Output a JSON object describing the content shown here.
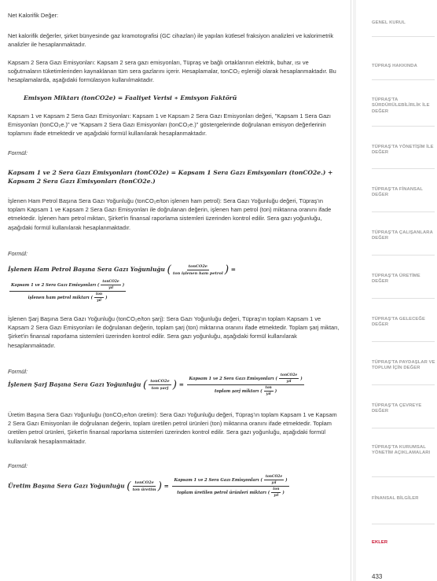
{
  "content": {
    "heading": "Net Kalorifik Değer:",
    "p1": "Net kalorifik değerler, şirket bünyesinde gaz kramotografisi (GC cihazları) ile yapılan kütlesel fraksiyon analizleri ve kalorimetrik analizler ile hesaplanmaktadır.",
    "p2": "Kapsam 2 Sera Gazı Emisyonları: Kapsam 2 sera gazı emisyonları, Tüpraş ve bağlı ortaklarının elektrik, buhar, ısı ve soğutmaların tüketimlerinden kaynaklanan tüm sera gazlarını içerir. Hesaplamalar, tonCO₂ eşleniği olarak hesaplanmaktadır. Bu hesaplamalarda, aşağıdaki formülasyon kullanılmaktadır.",
    "eq1": "Emisyon Miktarı (tonCO2e) = Faaliyet Verisi ∗ Emisyon Faktörü",
    "p3": "Kapsam 1 ve Kapsam 2 Sera Gazı Emisyonları: Kapsam 1 ve Kapsam 2 Sera Gazı Emisyonları değeri, \"Kapsam 1 Sera Gazı Emisyonları (tonCO₂e.)\" ve \"Kapsam 2 Sera Gazı Emisyonları (tonCO₂e.)\" göstergelerinde doğrulanan emisyon değerlerinin toplamını ifade etmektedir ve aşağıdaki formül kullanılarak hesaplanmaktadır.",
    "formula_label": "Formül:",
    "eq2_line1": "Kapsam 1 ve 2 Sera Gazı Emisyonları (tonCO2e) = Kapsam 1 Sera Gazı Emisyonları (tonCO2e.) +",
    "eq2_line2": "Kapsam 2 Sera Gazı Emisyonları (tonCO2e.)",
    "p4": "İşlenen Ham Petrol Başına Sera Gazı Yoğunluğu (tonCO₂e/ton işlenen ham petrol): Sera Gazı Yoğunluğu değeri, Tüpraş'ın toplam Kapsam 1 ve Kapsam 2 Sera Gazı Emisyonları ile doğrulanan değerin, işlenen ham petrol (ton) miktarına oranını ifade etmektedir. İşlenen ham petrol miktarı, Şirket'in finansal raporlama sistemleri üzerinden kontrol edilir. Sera gazı yoğunluğu, aşağıdaki formül kullanılarak hesaplanmaktadır.",
    "eq3_lhs": "İşlenen Ham Petrol Başına Sera Gazı Yoğunluğu",
    "eq3_num": "tonCO2e",
    "eq3_den": "ton işlenen ham petrol",
    "eq3_eq": "=",
    "eq3_big_num": "Kapsam 1 ve 2 Sera Gazı Emisyonları",
    "eq3_big_den": "işlenen ham petrol miktarı",
    "eq3_small_num": "tonCO2e",
    "eq3_small_den": "yıl",
    "eq3_small_num2": "ton",
    "eq3_small_den2": "yıl",
    "p5": "İşlenen Şarj Başına Sera Gazı Yoğunluğu (tonCO₂e/ton şarj): Sera Gazı Yoğunluğu değeri, Tüpraş'ın toplam Kapsam 1 ve Kapsam 2 Sera Gazı Emisyonları ile doğrulanan değerin, toplam şarj (ton) miktarına oranını ifade etmektedir. Toplam şarj miktarı, Şirket'in finansal raporlama sistemleri üzerinden kontrol edilir. Sera gazı yoğunluğu, aşağıdaki formül kullanılarak hesaplanmaktadır.",
    "eq4_lhs": "İşlenen Şarj Başına Sera Gazı Yoğunluğu",
    "eq4_num": "tonCO2e",
    "eq4_den": "ton şarj",
    "eq4_big_num": "Kapsam 1 ve 2 Sera Gazı Emisyonları",
    "eq4_big_den": "toplam şarj miktarı",
    "p6": "Üretim Başına Sera Gazı Yoğunluğu (tonCO₂e/ton üretim): Sera Gazı Yoğunluğu değeri, Tüpraş'ın toplam Kapsam 1 ve Kapsam 2 Sera Gazı Emisyonları ile doğrulanan değerin, toplam üretilen petrol ürünleri (ton) miktarına oranını ifade etmektedir. Toplam üretilen petrol ürünleri, Şirket'in finansal raporlama sistemleri üzerinden kontrol edilir. Sera gazı yoğunluğu, aşağıdaki formül kullanılarak hesaplanmaktadır.",
    "eq5_lhs": "Üretim Başına Sera Gazı Yoğunluğu",
    "eq5_num": "tonCO2e",
    "eq5_den": "ton üretim",
    "eq5_big_num": "Kapsam 1 ve 2 Sera Gazı Emisyonları",
    "eq5_big_den": "toplam üretilen petrol ürünleri miktarı"
  },
  "nav": {
    "items": [
      {
        "label": "GENEL KURUL"
      },
      {
        "label": "TÜPRAŞ HAKKINDA"
      },
      {
        "label": "TÜPRAŞ'TA SÜRDÜRÜLEBİLİRLİK İLE DEĞER"
      },
      {
        "label": "TÜPRAŞ'TA YÖNETİŞİM İLE DEĞER"
      },
      {
        "label": "TÜPRAŞ'TA FİNANSAL DEĞER"
      },
      {
        "label": "TÜPRAŞ'TA ÇALIŞANLARA DEĞER"
      },
      {
        "label": "TÜPRAŞ'TA ÜRETİME DEĞER"
      },
      {
        "label": "TÜPRAŞ'TA GELECEĞE DEĞER"
      },
      {
        "label": "TÜPRAŞ'TA PAYDAŞLAR VE TOPLUM İÇİN DEĞER"
      },
      {
        "label": "TÜPRAŞ'TA ÇEVREYE DEĞER"
      },
      {
        "label": "TÜPRAŞ'TA KURUMSAL YÖNETİM AÇIKLAMALARI"
      },
      {
        "label": "FİNANSAL BİLGİLER"
      },
      {
        "label": "EKLER"
      }
    ],
    "active_color": "#c8102e"
  },
  "page_number": "433"
}
